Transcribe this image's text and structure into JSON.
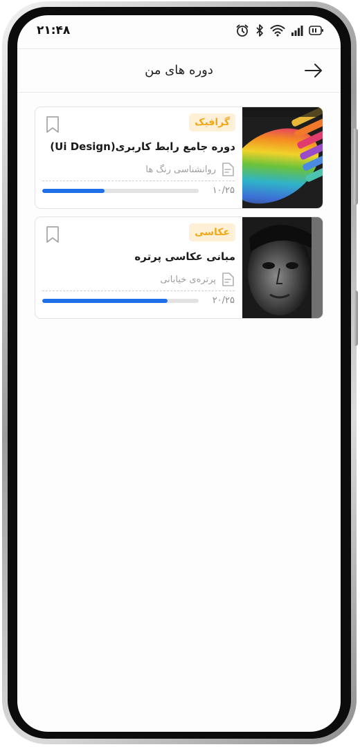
{
  "status_bar": {
    "time": "۲۱:۴۸"
  },
  "header": {
    "title": "دوره های من"
  },
  "courses": [
    {
      "category": "گرافیک",
      "title": "دوره جامع رابط کاربری(Ui Design)",
      "lesson": "روانشناسی رنگ ها",
      "progress_text": "۱۰/۲۵",
      "progress": 0.4,
      "image": "rainbow-chalk-pastels-photo"
    },
    {
      "category": "عکاسی",
      "title": "مبانی عکاسی پرتره",
      "lesson": "پرتره‌ی خیابانی",
      "progress_text": "۲۰/۲۵",
      "progress": 0.8,
      "image": "bw-man-portrait-photo"
    }
  ],
  "colors": {
    "accent": "#1e6fe8",
    "tag_bg": "#fdf0d6",
    "tag_text": "#f2a814"
  }
}
